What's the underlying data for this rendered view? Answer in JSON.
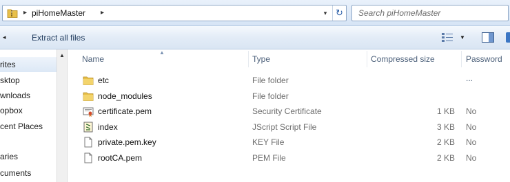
{
  "address": {
    "crumb": "piHomeMaster",
    "separator": "▸",
    "dropdown": "▾",
    "refresh": "↻"
  },
  "search": {
    "placeholder": "Search piHomeMaster"
  },
  "toolbar": {
    "extract_label": "Extract all files",
    "back_arrow": "◂",
    "view_drop": "▼"
  },
  "nav": {
    "scroll_up": "▲",
    "items": [
      {
        "label": "rites",
        "selected": true
      },
      {
        "label": "sktop"
      },
      {
        "label": "wnloads"
      },
      {
        "label": "opbox"
      },
      {
        "label": "cent Places"
      },
      {
        "label": ""
      },
      {
        "label": "aries"
      },
      {
        "label": "cuments"
      }
    ]
  },
  "columns": {
    "name": "Name",
    "type": "Type",
    "compressed_size": "Compressed size",
    "password": "Password ..."
  },
  "files": [
    {
      "name": "etc",
      "type": "File folder",
      "size": "",
      "password": "",
      "icon": "folder-icon"
    },
    {
      "name": "node_modules",
      "type": "File folder",
      "size": "",
      "password": "",
      "icon": "folder-icon"
    },
    {
      "name": "certificate.pem",
      "type": "Security Certificate",
      "size": "1 KB",
      "password": "No",
      "icon": "certificate-icon"
    },
    {
      "name": "index",
      "type": "JScript Script File",
      "size": "3 KB",
      "password": "No",
      "icon": "script-icon"
    },
    {
      "name": "private.pem.key",
      "type": "KEY File",
      "size": "2 KB",
      "password": "No",
      "icon": "file-icon"
    },
    {
      "name": "rootCA.pem",
      "type": "PEM File",
      "size": "2 KB",
      "password": "No",
      "icon": "file-icon"
    }
  ],
  "colors": {
    "folder": "#e8c04a",
    "header_text": "#4c607a",
    "link": "#1e395b"
  }
}
